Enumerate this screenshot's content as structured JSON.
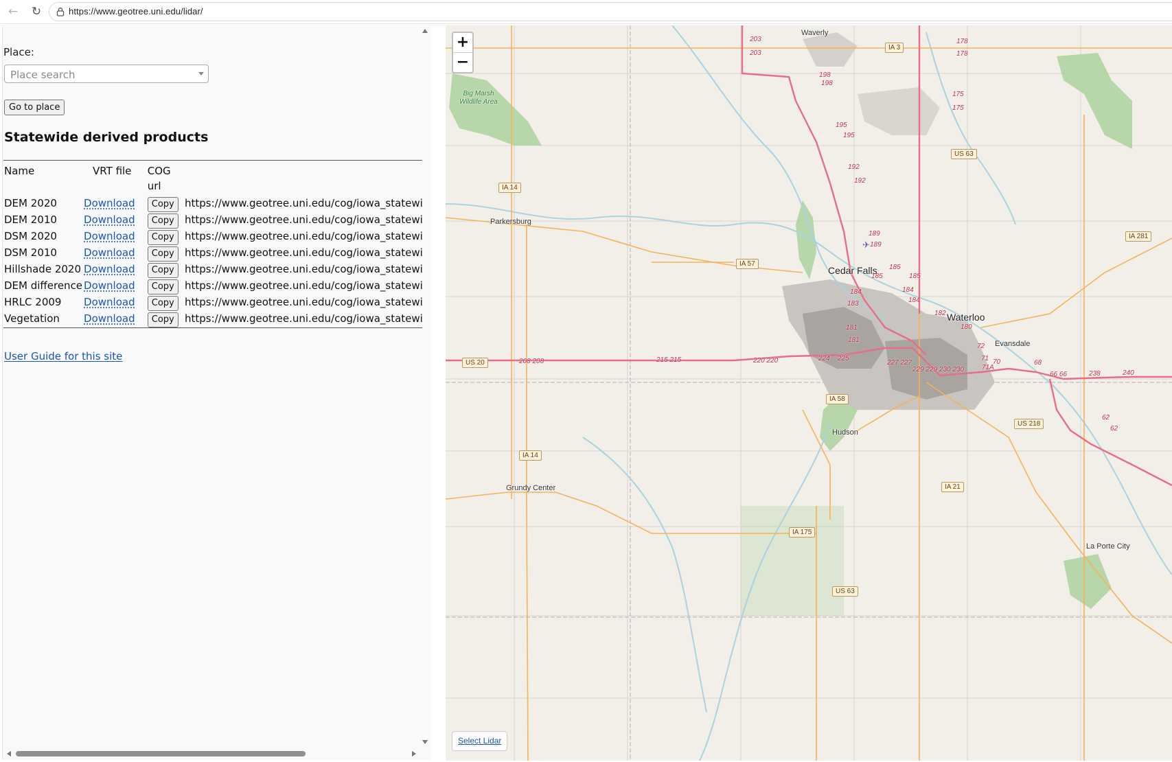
{
  "browser": {
    "url": "https://www.geotree.uni.edu/lidar/"
  },
  "panel": {
    "place_label": "Place:",
    "place_placeholder": "Place search",
    "goto_label": "Go to place",
    "section_title": "Statewide derived products",
    "columns": [
      "Name",
      "VRT file",
      "COG url"
    ],
    "download_label": "Download",
    "copy_label": "Copy",
    "rows": [
      {
        "name": "DEM 2020",
        "url": "https://www.geotree.uni.edu/cog/iowa_statewide"
      },
      {
        "name": "DEM 2010",
        "url": "https://www.geotree.uni.edu/cog/iowa_statewide"
      },
      {
        "name": "DSM 2020",
        "url": "https://www.geotree.uni.edu/cog/iowa_statewide"
      },
      {
        "name": "DSM 2010",
        "url": "https://www.geotree.uni.edu/cog/iowa_statewide"
      },
      {
        "name": "Hillshade 2020",
        "url": "https://www.geotree.uni.edu/cog/iowa_statewide"
      },
      {
        "name": "DEM difference",
        "url": "https://www.geotree.uni.edu/cog/iowa_statewide"
      },
      {
        "name": "HRLC 2009",
        "url": "https://www.geotree.uni.edu/cog/iowa_statewide"
      },
      {
        "name": "Vegetation",
        "url": "https://www.geotree.uni.edu/cog/iowa_statewide"
      }
    ],
    "user_guide_label": "User Guide for this site"
  },
  "map": {
    "zoom_in": "+",
    "zoom_out": "−",
    "select_lidar_label": "Select Lidar",
    "cities": {
      "waverly": "Waverly",
      "parkersburg": "Parkersburg",
      "cedar_falls": "Cedar Falls",
      "waterloo": "Waterloo",
      "evansdale": "Evansdale",
      "hudson": "Hudson",
      "grundy_center": "Grundy Center",
      "la_porte_city": "La Porte City"
    },
    "park": "Big Marsh Wildlife Area",
    "shields": {
      "ia3": "IA 3",
      "us63a": "US 63",
      "ia14a": "IA 14",
      "ia57": "IA 57",
      "ia281": "IA 281",
      "us20": "US 20",
      "ia58": "IA 58",
      "us218": "US 218",
      "ia14b": "IA 14",
      "ia21": "IA 21",
      "ia175": "IA 175",
      "us63b": "US 63"
    },
    "exits": {
      "e203a": "203",
      "e203b": "203",
      "e198a": "198",
      "e198b": "198",
      "e195a": "195",
      "e195b": "195",
      "e192a": "192",
      "e192b": "192",
      "e189a": "189",
      "e189b": "189",
      "e185a": "185",
      "e185b": "185",
      "e185c": "185",
      "e184a": "184",
      "e184b": "184",
      "e184c": "184",
      "e183": "183",
      "e182": "182",
      "e181a": "181",
      "e181b": "181",
      "e180": "180",
      "e178a": "178",
      "e178b": "178",
      "e175a": "175",
      "e175b": "175",
      "e208": "208 208",
      "e215": "215 215",
      "e220": "220 220",
      "e224": "224",
      "e225": "225",
      "e227": "227 227",
      "e229": "229 229 230 230",
      "e72": "72",
      "e71": "71",
      "e71a": "71A",
      "e70": "70",
      "e68": "68",
      "e66": "66 66",
      "e238": "238",
      "e240": "240",
      "e62a": "62",
      "e62b": "62"
    },
    "colors": {
      "land": "#f2efe9",
      "water": "#aad3df",
      "motorway": "#e66e8a",
      "primary": "#f5b25a",
      "urban": "#aaaaaa",
      "forest": "#add19e"
    }
  }
}
